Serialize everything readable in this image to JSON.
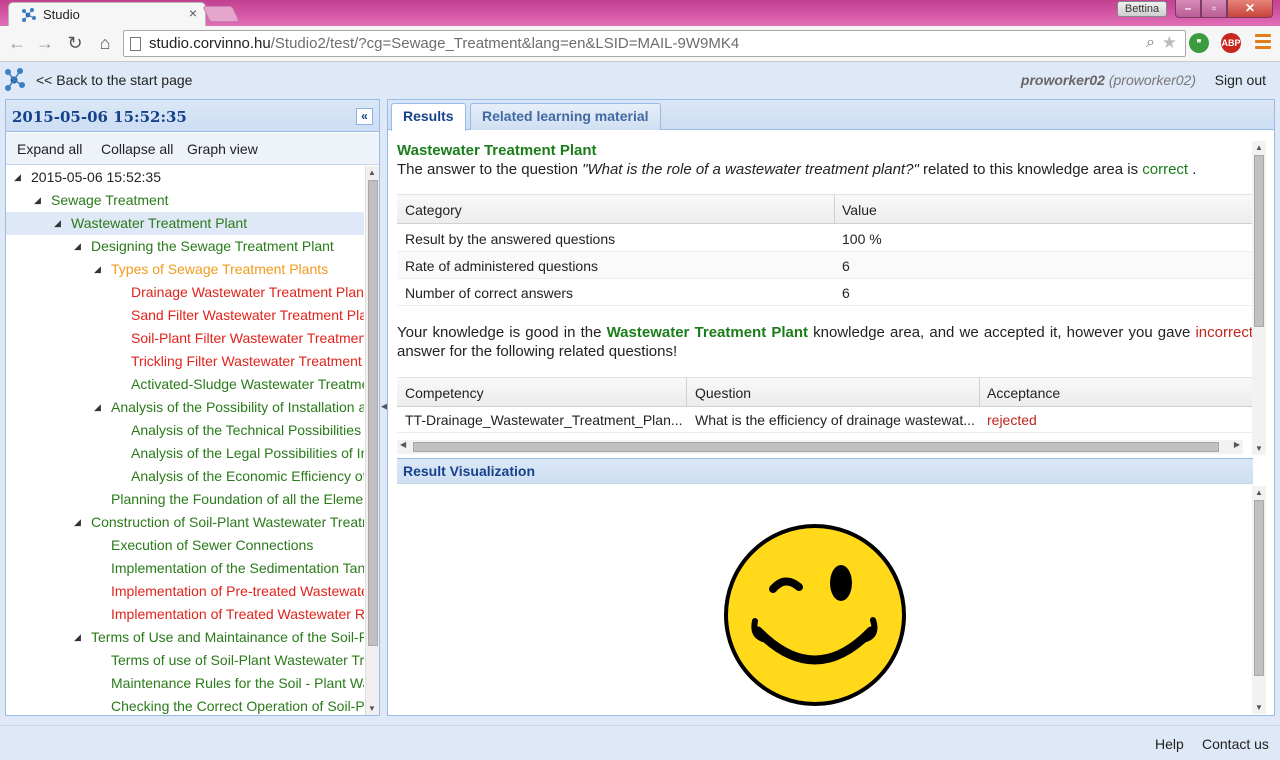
{
  "browser": {
    "tab_title": "Studio",
    "url_host": "studio.corvinno.hu",
    "url_rest": "/Studio2/test/?cg=Sewage_Treatment&lang=en&LSID=MAIL-9W9MK4",
    "profile_name": "Bettina",
    "extensions": [
      "hangouts-icon",
      "adblock-plus-icon"
    ],
    "abp_label": "ABP"
  },
  "header": {
    "back_link": "<< Back to the start page",
    "user_bold": "proworker02",
    "user_paren": "(proworker02)",
    "sign_out": "Sign out"
  },
  "left_panel": {
    "title": "2015-05-06 15:52:35",
    "toolbar": {
      "expand_all": "Expand all",
      "collapse_all": "Collapse all",
      "graph_view": "Graph view"
    },
    "tree": [
      {
        "label": "2015-05-06 15:52:35",
        "level": 0,
        "expanded": true,
        "color": "black"
      },
      {
        "label": "Sewage Treatment",
        "level": 1,
        "expanded": true,
        "color": "green"
      },
      {
        "label": "Wastewater Treatment Plant",
        "level": 2,
        "expanded": true,
        "color": "green",
        "selected": true
      },
      {
        "label": "Designing the Sewage Treatment Plant",
        "level": 3,
        "expanded": true,
        "color": "green"
      },
      {
        "label": "Types of Sewage Treatment Plants",
        "level": 4,
        "expanded": true,
        "color": "orange"
      },
      {
        "label": "Drainage Wastewater Treatment Plant",
        "level": 5,
        "color": "red"
      },
      {
        "label": "Sand Filter Wastewater Treatment Plar",
        "level": 5,
        "color": "red"
      },
      {
        "label": "Soil-Plant Filter Wastewater Treatment",
        "level": 5,
        "color": "red"
      },
      {
        "label": "Trickling Filter Wastewater Treatment ..",
        "level": 5,
        "color": "red"
      },
      {
        "label": "Activated-Sludge Wastewater Treatme",
        "level": 5,
        "color": "green"
      },
      {
        "label": "Analysis of the Possibility of Installation an",
        "level": 4,
        "expanded": true,
        "color": "green"
      },
      {
        "label": "Analysis of the Technical Possibilities of",
        "level": 5,
        "color": "green"
      },
      {
        "label": "Analysis of the Legal Possibilities of Ins",
        "level": 5,
        "color": "green"
      },
      {
        "label": "Analysis of the Economic Efficiency of I",
        "level": 5,
        "color": "green"
      },
      {
        "label": "Planning the Foundation of all the Elemen",
        "level": 4,
        "color": "green"
      },
      {
        "label": "Construction of Soil-Plant Wastewater Treatm",
        "level": 3,
        "expanded": true,
        "color": "green"
      },
      {
        "label": "Execution of Sewer Connections",
        "level": 4,
        "color": "green"
      },
      {
        "label": "Implementation of the Sedimentation Tan",
        "level": 4,
        "color": "green"
      },
      {
        "label": "Implementation of Pre-treated Wastewate",
        "level": 4,
        "color": "red"
      },
      {
        "label": "Implementation of Treated Wastewater R..",
        "level": 4,
        "color": "red"
      },
      {
        "label": "Terms of Use and Maintainance of the Soil-Pla",
        "level": 3,
        "expanded": true,
        "color": "green"
      },
      {
        "label": "Terms of use of Soil-Plant Wastewater Tre",
        "level": 4,
        "color": "green"
      },
      {
        "label": "Maintenance Rules for the Soil - Plant Was",
        "level": 4,
        "color": "green"
      },
      {
        "label": "Checking the Correct Operation of Soil-Pla",
        "level": 4,
        "color": "green"
      }
    ]
  },
  "tabs": {
    "results": "Results",
    "related": "Related learning material"
  },
  "results": {
    "title": "Wastewater Treatment Plant",
    "sentence_pre": "The answer to the question ",
    "sentence_question": "\"What is the role of a wastewater treatment plant?\"",
    "sentence_mid": " related to this knowledge area is ",
    "sentence_status": "correct",
    "sentence_end": " .",
    "table1": {
      "headers": [
        "Category",
        "Value"
      ],
      "rows": [
        [
          "Result by the answered questions",
          "100 %"
        ],
        [
          "Rate of administered questions",
          "6"
        ],
        [
          "Number of correct answers",
          "6"
        ]
      ]
    },
    "para_pre": "Your knowledge is good in the ",
    "para_area": "Wastewater Treatment Plant",
    "para_mid": " knowledge area, and we accepted it, however you gave ",
    "para_incorrect": "incorrect",
    "para_end": " answer for the following related questions!",
    "table2": {
      "headers": [
        "Competency",
        "Question",
        "Acceptance"
      ],
      "rows": [
        [
          "TT-Drainage_Wastewater_Treatment_Plan...",
          "What is the efficiency of drainage wastewat...",
          "rejected"
        ]
      ]
    },
    "viz_title": "Result Visualization",
    "smiley": "winking-smiley-icon"
  },
  "footer": {
    "help": "Help",
    "contact": "Contact us"
  },
  "colors": {
    "accent_blue": "#15428b",
    "correct_green": "#1a7d1a",
    "error_red": "#c0261c",
    "partial_orange": "#f29a1c",
    "smiley_yellow": "#ffd91a"
  }
}
